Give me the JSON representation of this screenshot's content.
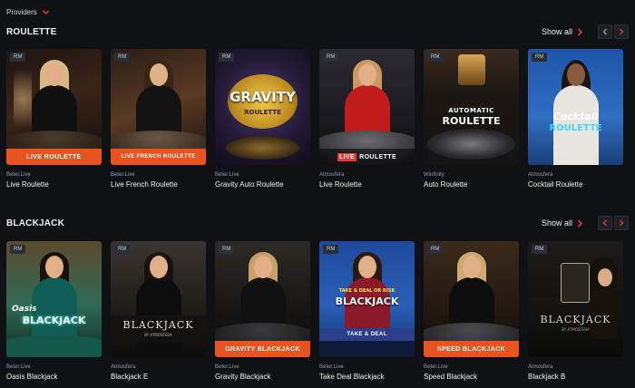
{
  "providers_filter": {
    "label": "Providers",
    "icon": "chevron-down-icon"
  },
  "roulette": {
    "title": "ROULETTE",
    "show_all": "Show all",
    "cards": [
      {
        "badge": "RM",
        "provider": "Beter.Live",
        "name": "Live Roulette",
        "art_text": "LIVE ROULETTE"
      },
      {
        "badge": "RM",
        "provider": "Beter.Live",
        "name": "Live French Roulette",
        "art_text": "LIVE FRENCH ROULETTE"
      },
      {
        "badge": "RM",
        "provider": "Beter.Live",
        "name": "Gravity Auto Roulette",
        "art_text": "GRAVITY",
        "art_sub": "ROULETTE"
      },
      {
        "badge": "RM",
        "provider": "Atmosfera",
        "name": "Live Roulette",
        "art_text": "LIVE",
        "art_sub": "ROULETTE"
      },
      {
        "badge": "RM",
        "provider": "Winfinity",
        "name": "Auto Roulette",
        "art_text": "AUTOMATIC",
        "art_sub": "ROULETTE"
      },
      {
        "badge": "RM",
        "provider": "Atmosfera",
        "name": "Cocktail Roulette",
        "art_text": "Cocktail",
        "art_sub": "ROULETTE"
      }
    ]
  },
  "blackjack": {
    "title": "BLACKJACK",
    "show_all": "Show all",
    "cards": [
      {
        "badge": "RM",
        "provider": "Beter.Live",
        "name": "Oasis Blackjack",
        "art_text": "Oasis",
        "art_sub": "BLACKJACK"
      },
      {
        "badge": "RM",
        "provider": "Atmosfera",
        "name": "Blackjack E",
        "art_text": "BLACKJACK",
        "art_sub": "BY ATMOSFERA"
      },
      {
        "badge": "RM",
        "provider": "Beter.Live",
        "name": "Gravity Blackjack",
        "art_text": "GRAVITY BLACKJACK"
      },
      {
        "badge": "RM",
        "provider": "Beter.Live",
        "name": "Take Deal Blackjack",
        "art_text": "TAKE & DEAL OR RISK",
        "art_sub": "BLACKJACK",
        "art_sub2": "TAKE & DEAL"
      },
      {
        "badge": "RM",
        "provider": "Beter.Live",
        "name": "Speed Blackjack",
        "art_text": "SPEED BLACKJACK"
      },
      {
        "badge": "RM",
        "provider": "Atmosfera",
        "name": "Blackjack B",
        "art_text": "BLACKJACK",
        "art_sub": "BY ATMOSFERA"
      }
    ]
  },
  "colors": {
    "accent": "#e53935",
    "background": "#0f1115",
    "banner_orange": "#e8531f"
  }
}
